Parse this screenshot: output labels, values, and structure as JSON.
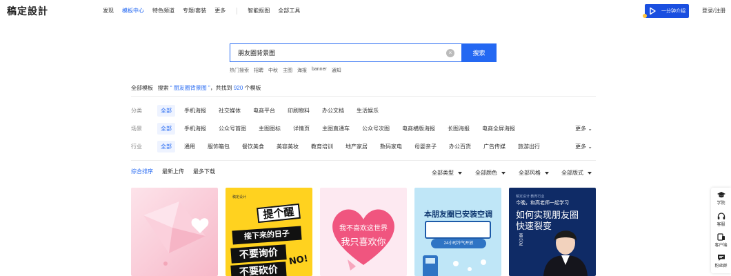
{
  "header": {
    "logo": "稿定設計",
    "nav": [
      {
        "label": "发现",
        "active": false
      },
      {
        "label": "模板中心",
        "active": true
      },
      {
        "label": "特色频道",
        "active": false
      },
      {
        "label": "专题/套装",
        "active": false
      },
      {
        "label": "更多",
        "active": false
      }
    ],
    "nav2": [
      {
        "label": "智能抠图"
      },
      {
        "label": "全部工具"
      }
    ],
    "intro_button": "一分钟介绍",
    "login": "登录/注册"
  },
  "search": {
    "value": "朋友圈背景图",
    "button": "搜索",
    "hot_label": "热门搜索",
    "hot_terms": [
      "招聘",
      "中秋",
      "主图",
      "海报",
      "banner",
      "通知"
    ]
  },
  "summary": {
    "prefix": "全部模板",
    "search_text": "搜索",
    "keyword": "“ 朋友圈背景图 ”",
    "found_text": "，共找到",
    "count": "920",
    "suffix": "个模板"
  },
  "filters": [
    {
      "label": "分类",
      "options": [
        "全部",
        "手机海报",
        "社交媒体",
        "电商平台",
        "印刷物料",
        "办公文档",
        "生活娱乐"
      ],
      "more": ""
    },
    {
      "label": "场景",
      "options": [
        "全部",
        "手机海报",
        "公众号首图",
        "主图图标",
        "详情页",
        "主图直通车",
        "公众号次图",
        "电商横版海报",
        "长图海报",
        "电商全屏海报"
      ],
      "more": "更多"
    },
    {
      "label": "行业",
      "options": [
        "全部",
        "通用",
        "服饰箱包",
        "餐饮美食",
        "美容美妆",
        "教育培训",
        "地产家居",
        "数码家电",
        "母婴亲子",
        "办公百货",
        "广告传媒",
        "旅游出行"
      ],
      "more": "更多"
    }
  ],
  "sort": {
    "options": [
      "综合排序",
      "最新上传",
      "最多下载"
    ],
    "active": "综合排序",
    "dropdowns": [
      "全部类型",
      "全部颜色",
      "全部风格",
      "全部版式"
    ]
  },
  "cards": {
    "c2": {
      "top": "稿定设计",
      "title": "提个醒",
      "t1": "接下来的日子",
      "t2": "不要询价",
      "t3": "不要砍价",
      "no": "NO!"
    },
    "c3": {
      "h1": "我不喜欢这世界",
      "h2": "我只喜欢你"
    },
    "c4": {
      "title": "本朋友圈已安装空调",
      "pill": "24小时冷气开放"
    },
    "c5": {
      "top": "稿定设计 教育行业",
      "line1": "今晚，和高老师一起学习",
      "line2": "如何实现朋友圈",
      "line3": "快速裂变",
      "vname": "高小定"
    }
  },
  "right_bar": [
    {
      "icon": "graduation-cap-icon",
      "label": "学院"
    },
    {
      "icon": "headset-icon",
      "label": "客服"
    },
    {
      "icon": "phone-icon",
      "label": "客户端"
    },
    {
      "icon": "chat-icon",
      "label": "粉丝群"
    }
  ],
  "colors": {
    "accent": "#2468f2",
    "intro_button": "#1a4fe0",
    "selected_bg": "#eef3ff"
  }
}
